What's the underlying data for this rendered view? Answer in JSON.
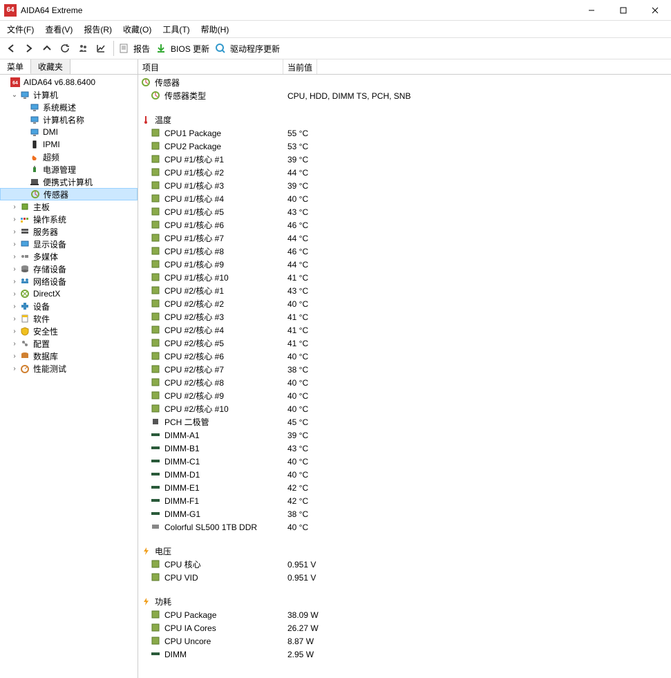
{
  "window": {
    "title": "AIDA64 Extreme",
    "logo": "64"
  },
  "menu": [
    "文件(F)",
    "查看(V)",
    "报告(R)",
    "收藏(O)",
    "工具(T)",
    "帮助(H)"
  ],
  "toolbar": {
    "report": "报告",
    "bios": "BIOS 更新",
    "driver": "驱动程序更新"
  },
  "sidetabs": {
    "menu": "菜单",
    "fav": "收藏夹"
  },
  "tree": {
    "root": "AIDA64 v6.88.6400",
    "computer": "计算机",
    "computer_children": [
      "系统概述",
      "计算机名称",
      "DMI",
      "IPMI",
      "超频",
      "电源管理",
      "便携式计算机",
      "传感器"
    ],
    "siblings": [
      "主板",
      "操作系统",
      "服务器",
      "显示设备",
      "多媒体",
      "存储设备",
      "网络设备",
      "DirectX",
      "设备",
      "软件",
      "安全性",
      "配置",
      "数据库",
      "性能测试"
    ]
  },
  "columns": {
    "item": "项目",
    "value": "当前值"
  },
  "sections": {
    "sensor": {
      "label": "传感器",
      "rows": [
        {
          "name": "传感器类型",
          "value": "CPU, HDD, DIMM TS, PCH, SNB",
          "icon": "sensor"
        }
      ]
    },
    "temp": {
      "label": "温度",
      "rows": [
        {
          "name": "CPU1 Package",
          "value": "55 °C",
          "icon": "cpu"
        },
        {
          "name": "CPU2 Package",
          "value": "53 °C",
          "icon": "cpu"
        },
        {
          "name": "CPU #1/核心 #1",
          "value": "39 °C",
          "icon": "cpu"
        },
        {
          "name": "CPU #1/核心 #2",
          "value": "44 °C",
          "icon": "cpu"
        },
        {
          "name": "CPU #1/核心 #3",
          "value": "39 °C",
          "icon": "cpu"
        },
        {
          "name": "CPU #1/核心 #4",
          "value": "40 °C",
          "icon": "cpu"
        },
        {
          "name": "CPU #1/核心 #5",
          "value": "43 °C",
          "icon": "cpu"
        },
        {
          "name": "CPU #1/核心 #6",
          "value": "46 °C",
          "icon": "cpu"
        },
        {
          "name": "CPU #1/核心 #7",
          "value": "44 °C",
          "icon": "cpu"
        },
        {
          "name": "CPU #1/核心 #8",
          "value": "46 °C",
          "icon": "cpu"
        },
        {
          "name": "CPU #1/核心 #9",
          "value": "44 °C",
          "icon": "cpu"
        },
        {
          "name": "CPU #1/核心 #10",
          "value": "41 °C",
          "icon": "cpu"
        },
        {
          "name": "CPU #2/核心 #1",
          "value": "43 °C",
          "icon": "cpu"
        },
        {
          "name": "CPU #2/核心 #2",
          "value": "40 °C",
          "icon": "cpu"
        },
        {
          "name": "CPU #2/核心 #3",
          "value": "41 °C",
          "icon": "cpu"
        },
        {
          "name": "CPU #2/核心 #4",
          "value": "41 °C",
          "icon": "cpu"
        },
        {
          "name": "CPU #2/核心 #5",
          "value": "41 °C",
          "icon": "cpu"
        },
        {
          "name": "CPU #2/核心 #6",
          "value": "40 °C",
          "icon": "cpu"
        },
        {
          "name": "CPU #2/核心 #7",
          "value": "38 °C",
          "icon": "cpu"
        },
        {
          "name": "CPU #2/核心 #8",
          "value": "40 °C",
          "icon": "cpu"
        },
        {
          "name": "CPU #2/核心 #9",
          "value": "40 °C",
          "icon": "cpu"
        },
        {
          "name": "CPU #2/核心 #10",
          "value": "40 °C",
          "icon": "cpu"
        },
        {
          "name": "PCH 二极管",
          "value": "45 °C",
          "icon": "pch"
        },
        {
          "name": "DIMM-A1",
          "value": "39 °C",
          "icon": "dimm"
        },
        {
          "name": "DIMM-B1",
          "value": "43 °C",
          "icon": "dimm"
        },
        {
          "name": "DIMM-C1",
          "value": "40 °C",
          "icon": "dimm"
        },
        {
          "name": "DIMM-D1",
          "value": "40 °C",
          "icon": "dimm"
        },
        {
          "name": "DIMM-E1",
          "value": "42 °C",
          "icon": "dimm"
        },
        {
          "name": "DIMM-F1",
          "value": "42 °C",
          "icon": "dimm"
        },
        {
          "name": "DIMM-G1",
          "value": "38 °C",
          "icon": "dimm"
        },
        {
          "name": "Colorful SL500 1TB DDR",
          "value": "40 °C",
          "icon": "ssd"
        }
      ]
    },
    "volt": {
      "label": "电压",
      "rows": [
        {
          "name": "CPU 核心",
          "value": "0.951 V",
          "icon": "cpu"
        },
        {
          "name": "CPU VID",
          "value": "0.951 V",
          "icon": "cpu"
        }
      ]
    },
    "power": {
      "label": "功耗",
      "rows": [
        {
          "name": "CPU Package",
          "value": "38.09 W",
          "icon": "cpu"
        },
        {
          "name": "CPU IA Cores",
          "value": "26.27 W",
          "icon": "cpu"
        },
        {
          "name": "CPU Uncore",
          "value": "8.87 W",
          "icon": "cpu"
        },
        {
          "name": "DIMM",
          "value": "2.95 W",
          "icon": "dimm"
        }
      ]
    }
  }
}
